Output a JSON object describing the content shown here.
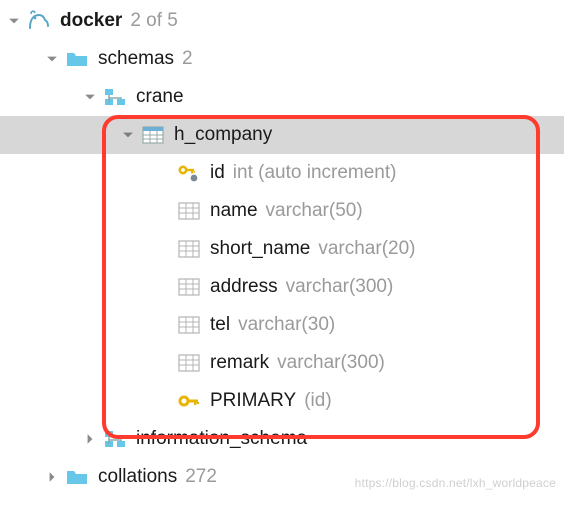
{
  "root": {
    "name": "docker",
    "badge": "2 of 5"
  },
  "schemas": {
    "label": "schemas",
    "count": "2",
    "items": {
      "crane": {
        "label": "crane",
        "table": {
          "label": "h_company",
          "columns": [
            {
              "name": "id",
              "type": "int (auto increment)",
              "pk": true
            },
            {
              "name": "name",
              "type": "varchar(50)",
              "pk": false
            },
            {
              "name": "short_name",
              "type": "varchar(20)",
              "pk": false
            },
            {
              "name": "address",
              "type": "varchar(300)",
              "pk": false
            },
            {
              "name": "tel",
              "type": "varchar(30)",
              "pk": false
            },
            {
              "name": "remark",
              "type": "varchar(300)",
              "pk": false
            }
          ],
          "primary": {
            "label": "PRIMARY",
            "cols": "(id)"
          }
        }
      },
      "information_schema": {
        "label": "information_schema"
      }
    }
  },
  "collations": {
    "label": "collations",
    "count": "272"
  },
  "watermark": "https://blog.csdn.net/lxh_worldpeace"
}
